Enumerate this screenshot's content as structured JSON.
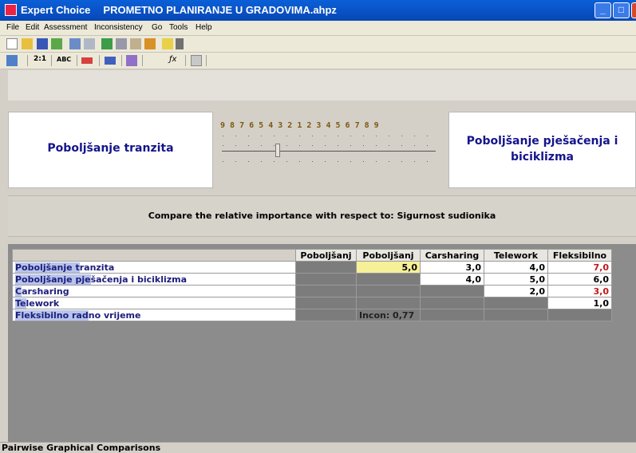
{
  "window": {
    "app_name": "Expert Choice",
    "document": "PROMETNO PLANIRANJE U GRADOVIMA.ahpz"
  },
  "menu": [
    "File",
    "Edit",
    "Assessment",
    "Inconsistency",
    "Go",
    "Tools",
    "Help"
  ],
  "toolbar2_labels": [
    "2:1",
    "ABC",
    "ƒx"
  ],
  "comparison": {
    "left_item": "Poboljšanje tranzita",
    "right_item": "Poboljšanje pješačenja i biciklizma",
    "scale_numbers": "9 8 7 6 5 4 3 2 1 2 3 4 5 6 7 8 9",
    "slider_value": 5.0,
    "prompt": "Compare the relative importance with respect to: Sigurnost sudionika"
  },
  "matrix": {
    "columns": [
      "Poboljšanj",
      "Poboljšanj",
      "Carsharing",
      "Telework",
      "Fleksibilno"
    ],
    "rows": [
      {
        "pre": "Poboljšanje t",
        "post": "ranzita",
        "cells": [
          "",
          "5,0",
          "3,0",
          "4,0",
          "7,0"
        ]
      },
      {
        "pre": "Poboljšanje pje",
        "post": "šačenja i biciklizma",
        "cells": [
          "",
          "",
          "4,0",
          "5,0",
          "6,0"
        ]
      },
      {
        "pre": "C",
        "post": "arsharing",
        "cells": [
          "",
          "",
          "",
          "2,0",
          "3,0"
        ]
      },
      {
        "pre": "Te",
        "post": "lework",
        "cells": [
          "",
          "",
          "",
          "",
          "1,0"
        ]
      },
      {
        "pre": "Fleksibilno rad",
        "post": "no vrijeme",
        "cells": [
          "",
          "Incon: 0,77",
          "",
          "",
          ""
        ]
      }
    ]
  },
  "status": "Pairwise Graphical Comparisons"
}
